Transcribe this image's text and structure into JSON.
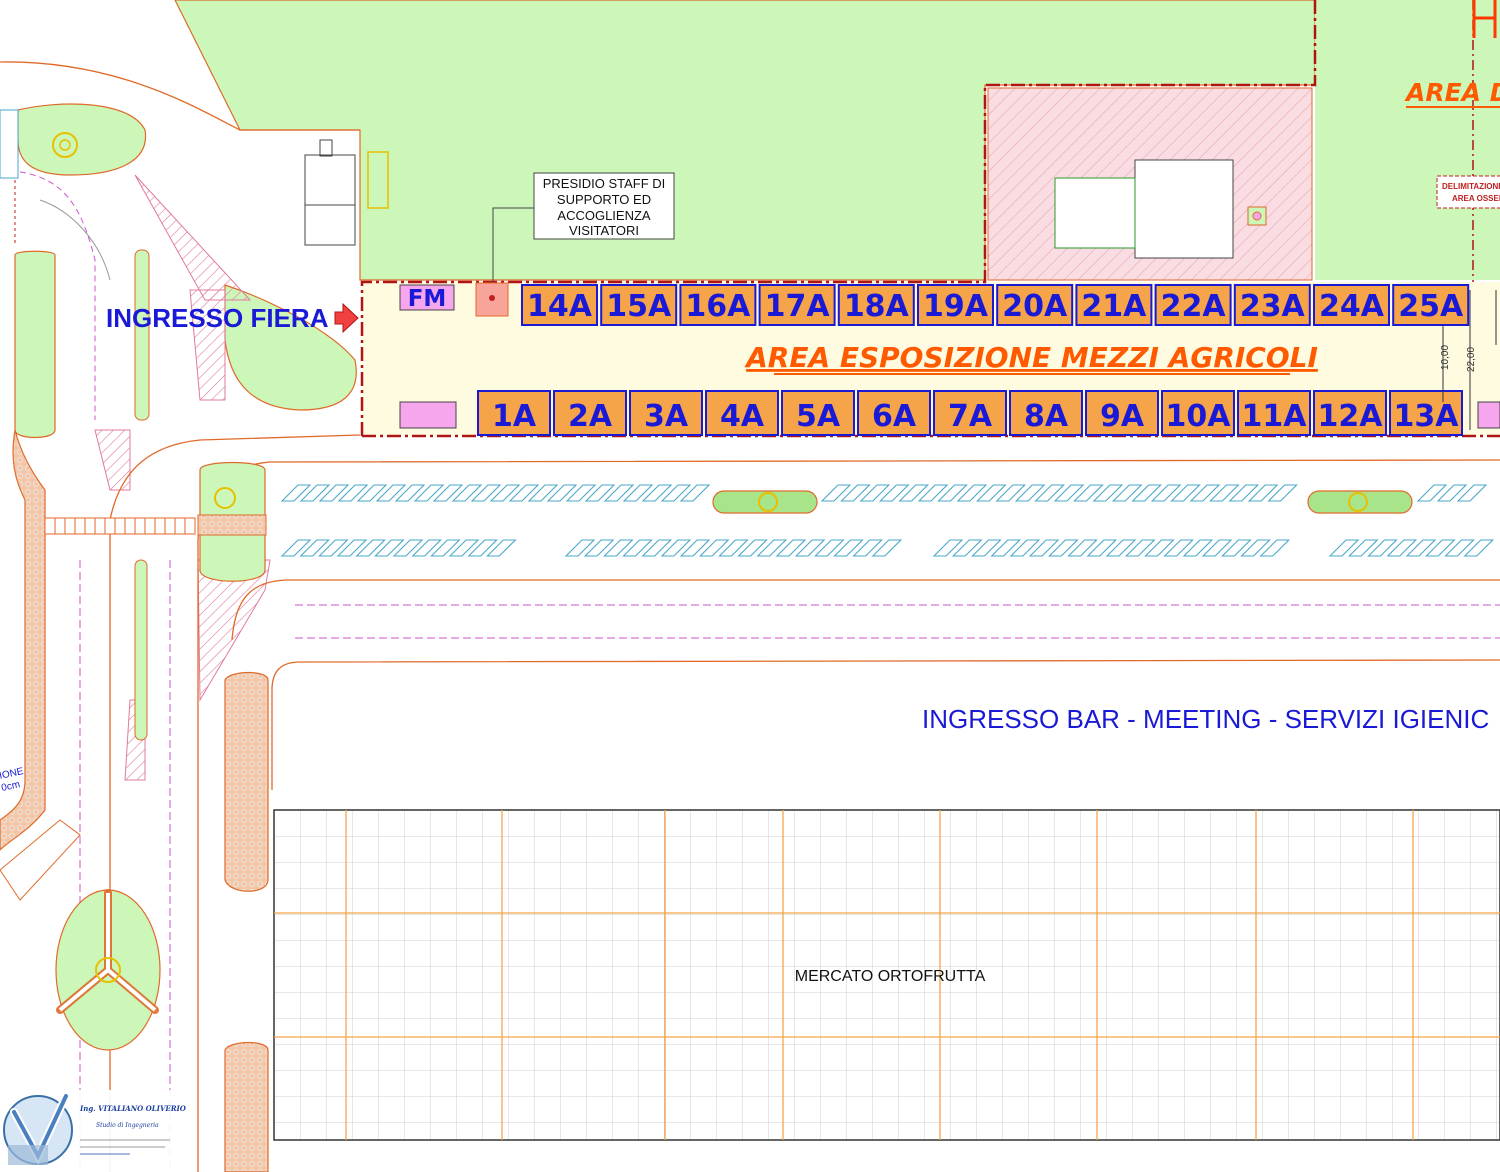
{
  "labels": {
    "entrance": "INGRESSO FIERA",
    "staff_line1": "PRESIDIO STAFF DI",
    "staff_line2": "SUPPORTO ED",
    "staff_line3": "ACCOGLIENZA",
    "staff_line4": "VISITATORI",
    "fm": "FM",
    "exhibition_area": "AREA ESPOSIZIONE  MEZZI AGRICOLI",
    "area_d": "AREA D",
    "delim_line1": "DELIMITAZIONE",
    "delim_line2": "AREA OSSER",
    "bar_entrance": "INGRESSO BAR - MEETING - SERVIZI IGIENIC",
    "market": "MERCATO ORTOFRUTTA",
    "dim_10": "10,00",
    "dim_22": "22,00",
    "left_note1": "IONE",
    "left_note2": "0cm",
    "engineer_name": "Ing. VITALIANO OLIVERIO",
    "engineer_studio": "Studio di Ingegneria"
  },
  "stands_top": [
    "14A",
    "15A",
    "16A",
    "17A",
    "18A",
    "19A",
    "20A",
    "21A",
    "22A",
    "23A",
    "24A",
    "25A"
  ],
  "stands_bottom": [
    "1A",
    "2A",
    "3A",
    "4A",
    "5A",
    "6A",
    "7A",
    "8A",
    "9A",
    "10A",
    "11A",
    "12A",
    "13A"
  ],
  "colors": {
    "grass": "#ccf7b8",
    "road": "#f4f4f4",
    "stand_fill": "#f5a44a",
    "stand_border": "#1a1ad6",
    "area_fill": "#fffbe0",
    "area_border": "#b01515",
    "accent_orange": "#ff5a00",
    "paving": "#f6c6a4",
    "roof_pink": "#f7cfd6",
    "fm_fill": "#f6a6ec",
    "text_blue": "#1a1ad6"
  }
}
